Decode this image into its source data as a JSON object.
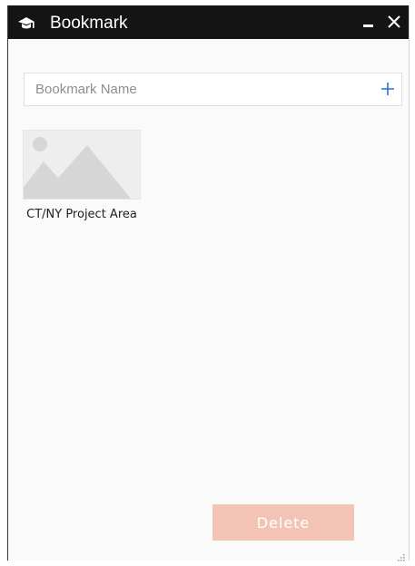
{
  "window": {
    "title": "Bookmark",
    "icons": {
      "app": "bookmark-app-icon",
      "minimize": "minimize-icon",
      "close": "close-icon"
    }
  },
  "name_field": {
    "placeholder": "Bookmark Name",
    "value": "",
    "add_icon": "plus-icon"
  },
  "bookmarks": [
    {
      "label": "CT/NY Project Area",
      "thumbnail_icon": "image-placeholder-icon"
    }
  ],
  "actions": {
    "delete_label": "Delete"
  },
  "colors": {
    "titlebar": "#141414",
    "accent": "#2f6fcb",
    "delete_button": "#f3c3b5"
  }
}
